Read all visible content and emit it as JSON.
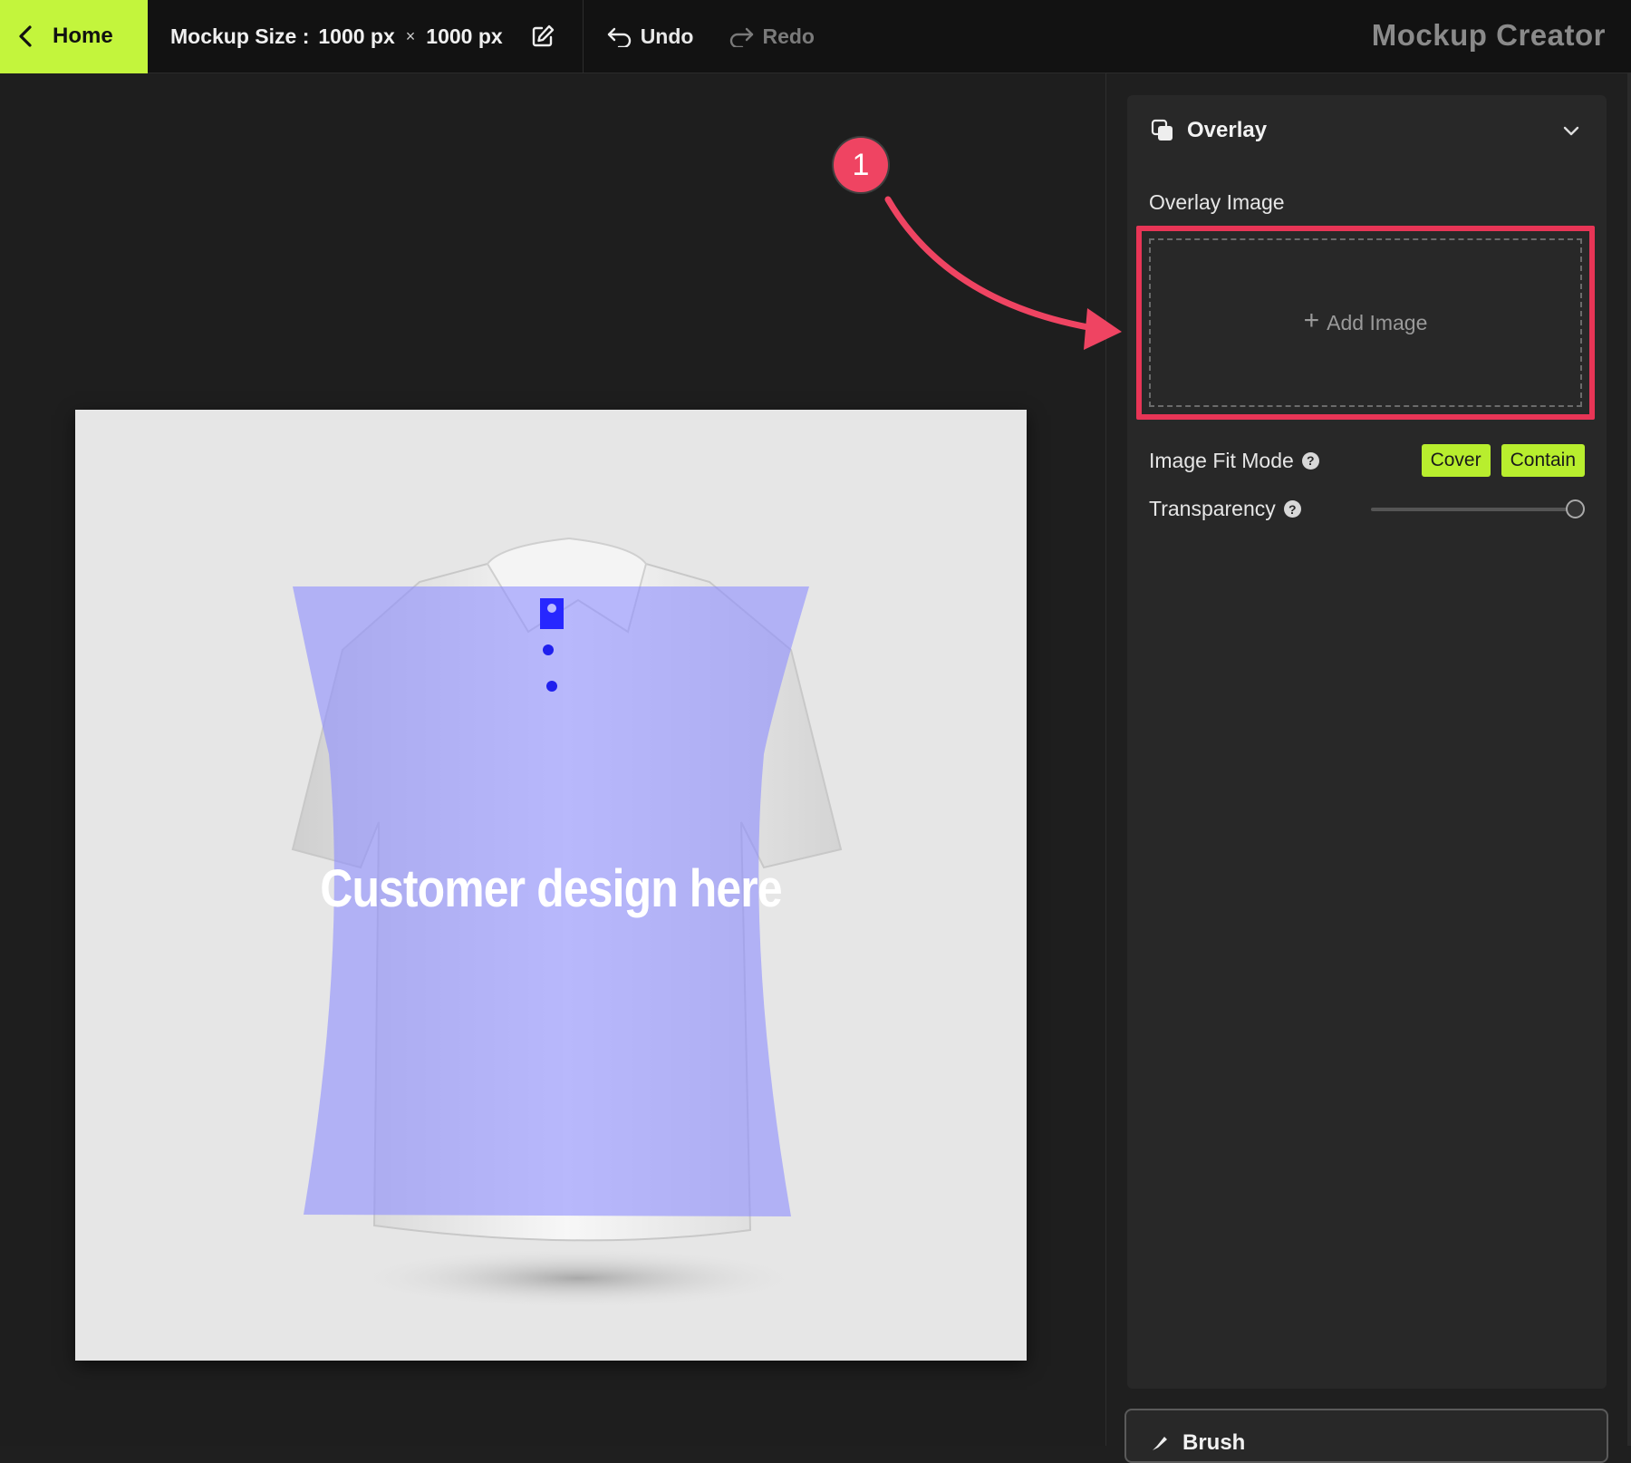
{
  "topbar": {
    "home_label": "Home",
    "size_label": "Mockup Size :",
    "width_value": "1000 px",
    "times": "×",
    "height_value": "1000 px",
    "undo_label": "Undo",
    "redo_label": "Redo",
    "app_title": "Mockup Creator"
  },
  "canvas": {
    "design_text": "Customer design here",
    "overlay_color": "#8e8eff",
    "background": "#e6e6e6"
  },
  "annotation": {
    "step_number": "1",
    "color": "#ef4462"
  },
  "overlay_panel": {
    "title": "Overlay",
    "overlay_image_label": "Overlay Image",
    "add_image_label": "Add Image",
    "fit_mode_label": "Image Fit Mode",
    "fit_options": [
      "Cover",
      "Contain"
    ],
    "transparency_label": "Transparency",
    "transparency_value": 1.0,
    "help_glyph": "?",
    "accent": "#b8ee2e"
  },
  "brush_panel": {
    "title": "Brush"
  }
}
